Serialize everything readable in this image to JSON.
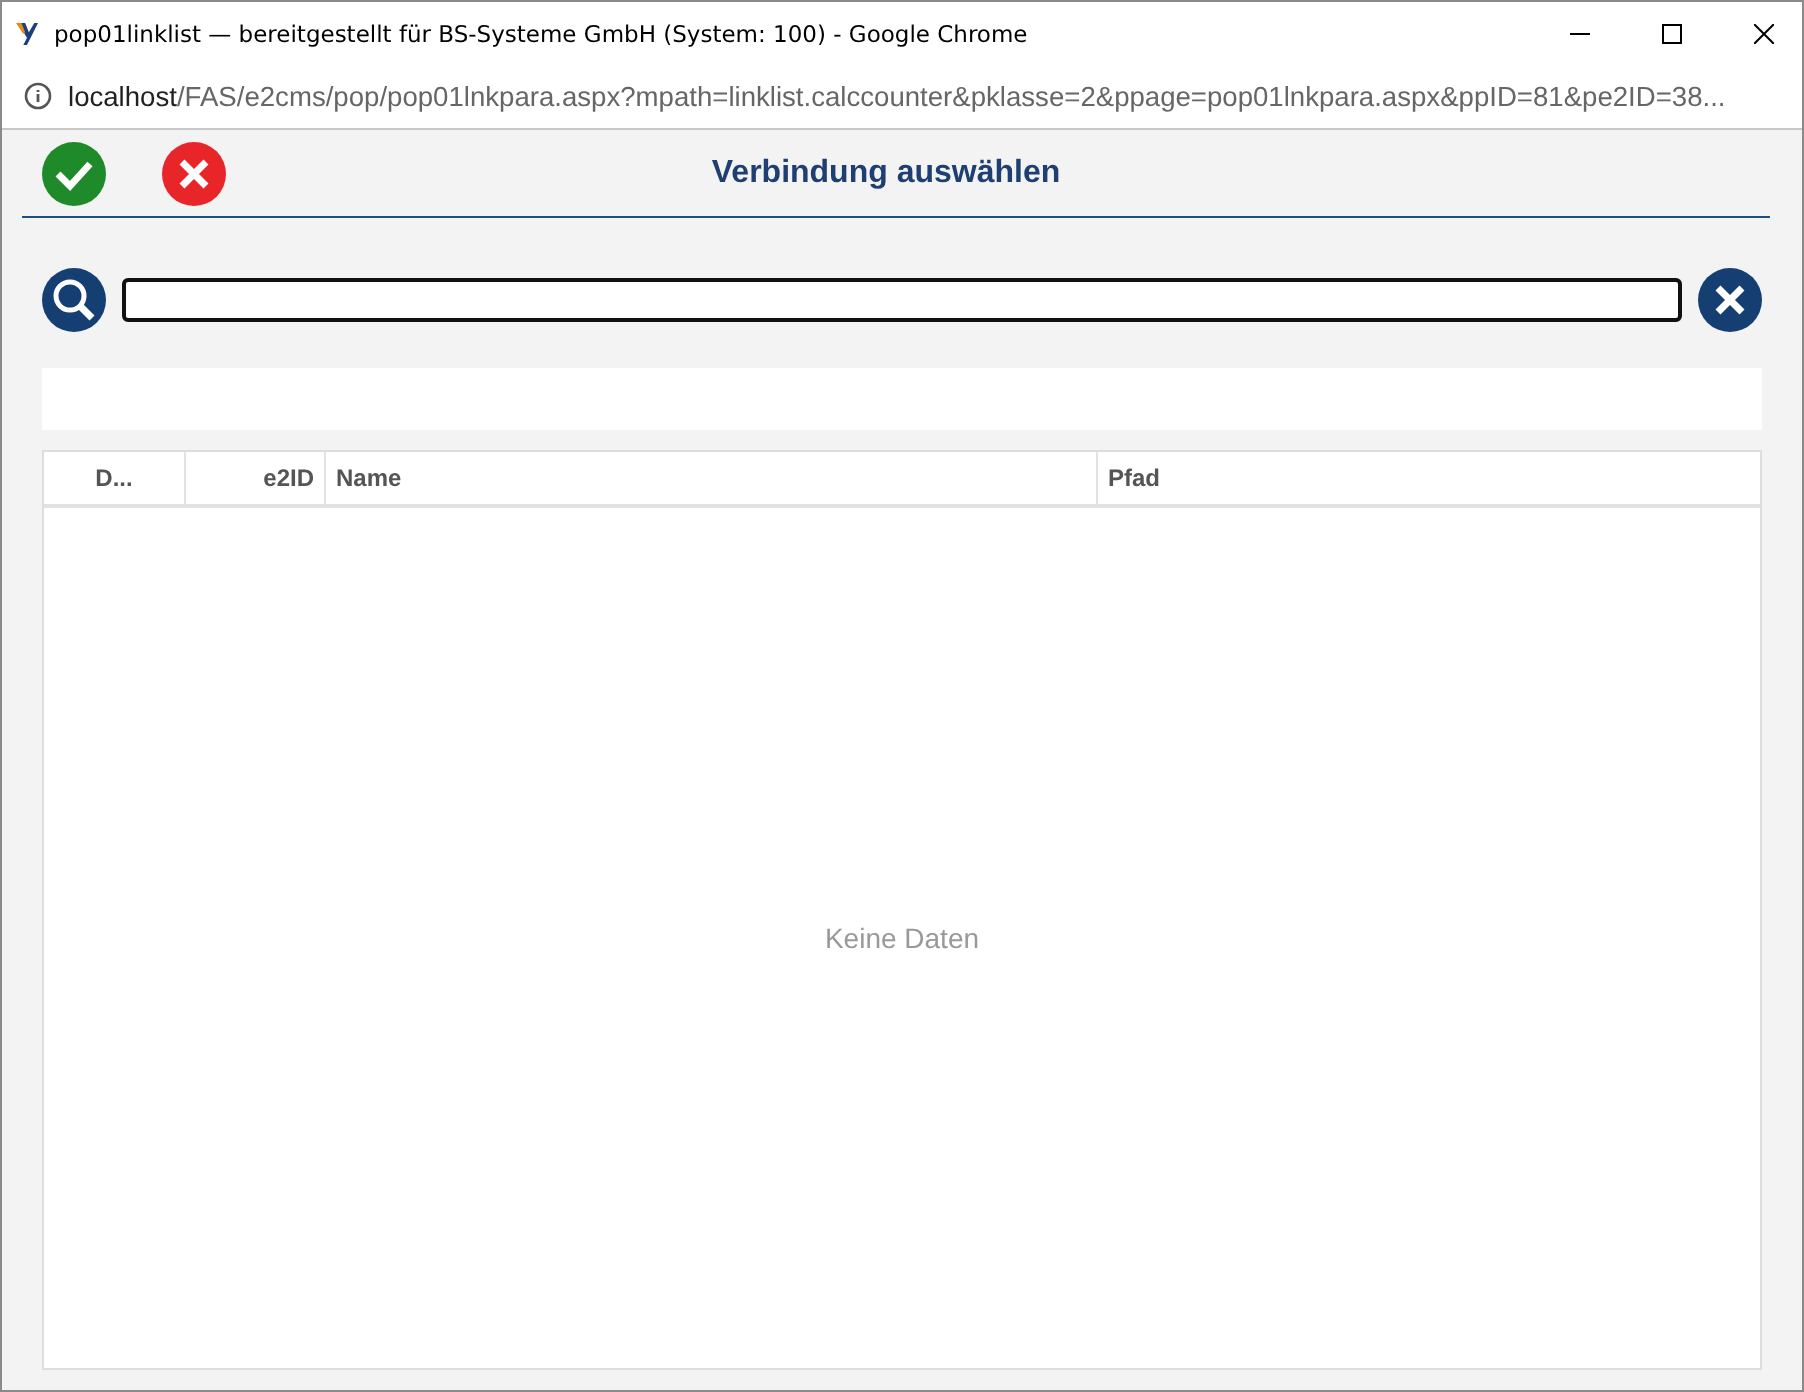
{
  "window": {
    "title": "pop01linklist — bereitgestellt für BS-Systeme GmbH (System: 100) - Google Chrome"
  },
  "address_bar": {
    "host": "localhost",
    "path": "/FAS/e2cms/pop/pop01lnkpara.aspx?mpath=linklist.calccounter&pklasse=2&ppage=pop01lnkpara.aspx&ppID=81&pe2ID=38..."
  },
  "dialog": {
    "title": "Verbindung auswählen"
  },
  "table": {
    "columns": [
      {
        "label": "D..."
      },
      {
        "label": "e2ID"
      },
      {
        "label": "Name"
      },
      {
        "label": "Pfad"
      }
    ],
    "empty_text": "Keine Daten"
  }
}
